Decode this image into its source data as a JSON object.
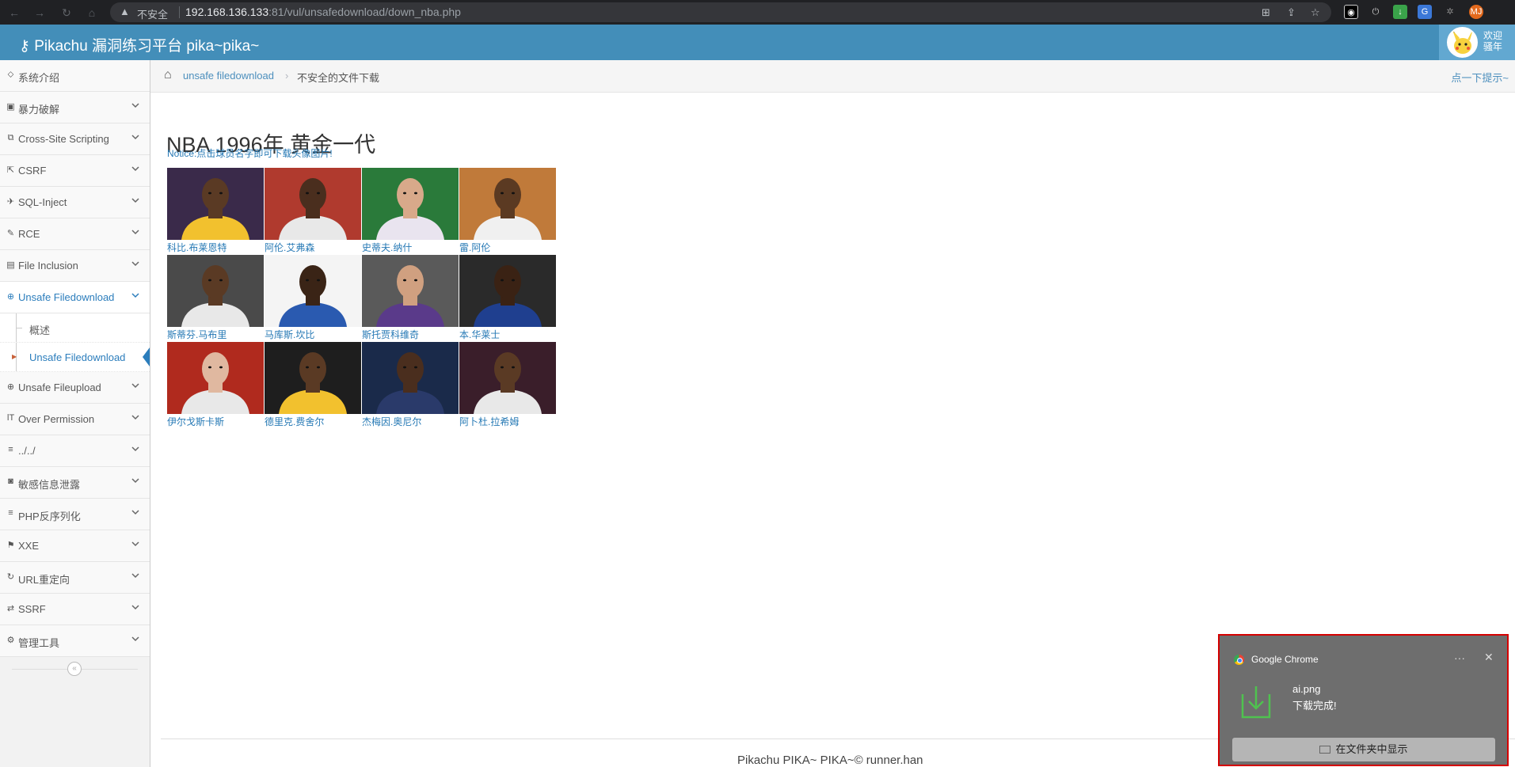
{
  "browser": {
    "insecure_label": "不安全",
    "url_host": "192.168.136.133",
    "url_rest": ":81/vul/unsafedownload/down_nba.php",
    "profile_initials": "MJ"
  },
  "header": {
    "title": "Pikachu 漏洞练习平台 pika~pika~",
    "welcome_line1": "欢迎",
    "welcome_line2": "骚年"
  },
  "sidebar": {
    "items": [
      {
        "label": "系统介绍",
        "icon": "tag-icon",
        "glyph": "⬦",
        "has_children": false
      },
      {
        "label": "暴力破解",
        "icon": "lock-icon",
        "glyph": "▣",
        "has_children": true
      },
      {
        "label": "Cross-Site Scripting",
        "icon": "sitemap-icon",
        "glyph": "⧉",
        "has_children": true
      },
      {
        "label": "CSRF",
        "icon": "share-icon",
        "glyph": "⇱",
        "has_children": true
      },
      {
        "label": "SQL-Inject",
        "icon": "fighter-jet-icon",
        "glyph": "✈",
        "has_children": true
      },
      {
        "label": "RCE",
        "icon": "pencil-icon",
        "glyph": "✎",
        "has_children": true
      },
      {
        "label": "File Inclusion",
        "icon": "file-icon",
        "glyph": "▤",
        "has_children": true
      },
      {
        "label": "Unsafe Filedownload",
        "icon": "download-icon",
        "glyph": "⊕",
        "has_children": true,
        "active": true
      },
      {
        "label": "Unsafe Fileupload",
        "icon": "upload-icon",
        "glyph": "⊕",
        "has_children": true
      },
      {
        "label": "Over Permission",
        "icon": "text-height-icon",
        "glyph": "ǀT",
        "has_children": true
      },
      {
        "label": "../../",
        "icon": "align-left-icon",
        "glyph": "≡",
        "has_children": true
      },
      {
        "label": "敏感信息泄露",
        "icon": "camera-icon",
        "glyph": "◙",
        "has_children": true
      },
      {
        "label": "PHP反序列化",
        "icon": "align-justify-icon",
        "glyph": "≡",
        "has_children": true
      },
      {
        "label": "XXE",
        "icon": "flag-icon",
        "glyph": "⚑",
        "has_children": true
      },
      {
        "label": "URL重定向",
        "icon": "refresh-icon",
        "glyph": "↻",
        "has_children": true
      },
      {
        "label": "SSRF",
        "icon": "exchange-icon",
        "glyph": "⇄",
        "has_children": true
      },
      {
        "label": "管理工具",
        "icon": "cog-icon",
        "glyph": "⚙",
        "has_children": true
      }
    ],
    "subitems": [
      {
        "label": "概述",
        "active": false
      },
      {
        "label": "Unsafe Filedownload",
        "active": true
      }
    ]
  },
  "breadcrumb": {
    "parent": "unsafe filedownload",
    "current": "不安全的文件下载",
    "hint": "点一下提示~"
  },
  "main": {
    "title": "NBA 1996年 黄金一代",
    "notice": "Notice:点击球员名字即可下载头像图片!",
    "players": [
      {
        "name": "科比.布莱恩特",
        "jersey": "#f2c12e",
        "skin": "#5a3a24",
        "bg": "#3a2a4a"
      },
      {
        "name": "阿伦.艾弗森",
        "jersey": "#e8e8e8",
        "skin": "#4a2e1e",
        "bg": "#b03a2e"
      },
      {
        "name": "史蒂夫.纳什",
        "jersey": "#e9e4ef",
        "skin": "#d8a98a",
        "bg": "#2a7a3a"
      },
      {
        "name": "雷.阿伦",
        "jersey": "#f0f0f0",
        "skin": "#5b3a22",
        "bg": "#c07a3a"
      },
      {
        "name": "斯蒂芬.马布里",
        "jersey": "#e8e8e8",
        "skin": "#5a3a24",
        "bg": "#4a4a4a"
      },
      {
        "name": "马库斯.坎比",
        "jersey": "#2a5ab0",
        "skin": "#3a2416",
        "bg": "#f4f4f4"
      },
      {
        "name": "斯托贾科维奇",
        "jersey": "#5a3a8a",
        "skin": "#d0a080",
        "bg": "#5a5a5a"
      },
      {
        "name": "本.华莱士",
        "jersey": "#1f3f8f",
        "skin": "#3a2214",
        "bg": "#2a2a2a"
      },
      {
        "name": "伊尔戈斯卡斯",
        "jersey": "#e8e8e8",
        "skin": "#e0b8a0",
        "bg": "#b02a1e"
      },
      {
        "name": "德里克.费舍尔",
        "jersey": "#f2c12e",
        "skin": "#5a3a24",
        "bg": "#1e1e1e"
      },
      {
        "name": "杰梅因.奥尼尔",
        "jersey": "#2a3a6a",
        "skin": "#4a2e1e",
        "bg": "#1a2a4a"
      },
      {
        "name": "阿卜杜.拉希姆",
        "jersey": "#e8e8e8",
        "skin": "#5a3a24",
        "bg": "#3a1e2a"
      }
    ]
  },
  "footer": {
    "text": "Pikachu PIKA~ PIKA~© runner.han"
  },
  "notification": {
    "app": "Google Chrome",
    "more": "···",
    "close": "✕",
    "filename": "ai.png",
    "status": "下载完成!",
    "button": "在文件夹中显示"
  }
}
